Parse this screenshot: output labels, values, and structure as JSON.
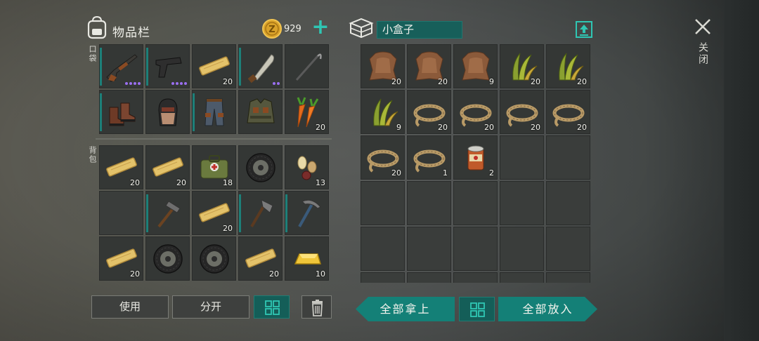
{
  "inventory": {
    "title": "物品栏",
    "coins": "929",
    "plus_label": "+",
    "pocket_label": "口袋",
    "backpack_label": "背包",
    "pocket_slots": [
      {
        "item": "shotgun-icon",
        "qty": "",
        "dots": 4
      },
      {
        "item": "pistol-icon",
        "qty": "",
        "dots": 4
      },
      {
        "item": "plank-icon",
        "qty": "20",
        "dots": 0
      },
      {
        "item": "machete-icon",
        "qty": "",
        "dots": 2
      },
      {
        "item": "hook-icon",
        "qty": "",
        "dots": 0
      },
      {
        "item": "boots-icon",
        "qty": "",
        "dots": 0
      },
      {
        "item": "helmet-icon",
        "qty": "",
        "dots": 0
      },
      {
        "item": "pants-icon",
        "qty": "",
        "dots": 0
      },
      {
        "item": "armor-vest-icon",
        "qty": "",
        "dots": 0
      },
      {
        "item": "carrot-icon",
        "qty": "20",
        "dots": 0
      }
    ],
    "backpack_slots": [
      {
        "item": "plank-icon",
        "qty": "20"
      },
      {
        "item": "plank-icon",
        "qty": "20"
      },
      {
        "item": "medkit-icon",
        "qty": "18"
      },
      {
        "item": "tire-icon",
        "qty": ""
      },
      {
        "item": "seeds-icon",
        "qty": "13"
      },
      {
        "item": "",
        "qty": ""
      },
      {
        "item": "hammer-icon",
        "qty": ""
      },
      {
        "item": "plank-icon",
        "qty": "20"
      },
      {
        "item": "hatchet-icon",
        "qty": ""
      },
      {
        "item": "pickaxe-icon",
        "qty": ""
      },
      {
        "item": "plank-icon",
        "qty": "20"
      },
      {
        "item": "tire-icon",
        "qty": ""
      },
      {
        "item": "tire-icon",
        "qty": ""
      },
      {
        "item": "plank-icon",
        "qty": "20"
      },
      {
        "item": "gold-bar-icon",
        "qty": "10"
      }
    ],
    "buttons": {
      "use": "使用",
      "split": "分开"
    }
  },
  "container": {
    "name": "小盒子",
    "slots": [
      {
        "item": "leather-icon",
        "qty": "20"
      },
      {
        "item": "leather-icon",
        "qty": "20"
      },
      {
        "item": "leather-icon",
        "qty": "9"
      },
      {
        "item": "grass-icon",
        "qty": "20"
      },
      {
        "item": "grass-icon",
        "qty": "20"
      },
      {
        "item": "grass-icon",
        "qty": "9"
      },
      {
        "item": "rope-icon",
        "qty": "20"
      },
      {
        "item": "rope-icon",
        "qty": "20"
      },
      {
        "item": "rope-icon",
        "qty": "20"
      },
      {
        "item": "rope-icon",
        "qty": "20"
      },
      {
        "item": "rope-icon",
        "qty": "20"
      },
      {
        "item": "rope-icon",
        "qty": "1"
      },
      {
        "item": "tin-can-icon",
        "qty": "2"
      },
      {
        "item": "",
        "qty": ""
      },
      {
        "item": "",
        "qty": ""
      },
      {
        "item": "",
        "qty": ""
      },
      {
        "item": "",
        "qty": ""
      },
      {
        "item": "",
        "qty": ""
      },
      {
        "item": "",
        "qty": ""
      },
      {
        "item": "",
        "qty": ""
      },
      {
        "item": "",
        "qty": ""
      },
      {
        "item": "",
        "qty": ""
      },
      {
        "item": "",
        "qty": ""
      },
      {
        "item": "",
        "qty": ""
      },
      {
        "item": "",
        "qty": ""
      },
      {
        "item": "",
        "qty": ""
      },
      {
        "item": "",
        "qty": ""
      },
      {
        "item": "",
        "qty": ""
      },
      {
        "item": "",
        "qty": ""
      },
      {
        "item": "",
        "qty": ""
      }
    ],
    "buttons": {
      "take_all": "全部拿上",
      "put_all": "全部放入"
    }
  },
  "close_label": "关闭",
  "colors": {
    "accent": "#2fc6b3",
    "button_teal": "#148077",
    "rarity": "#9a6ff0"
  }
}
